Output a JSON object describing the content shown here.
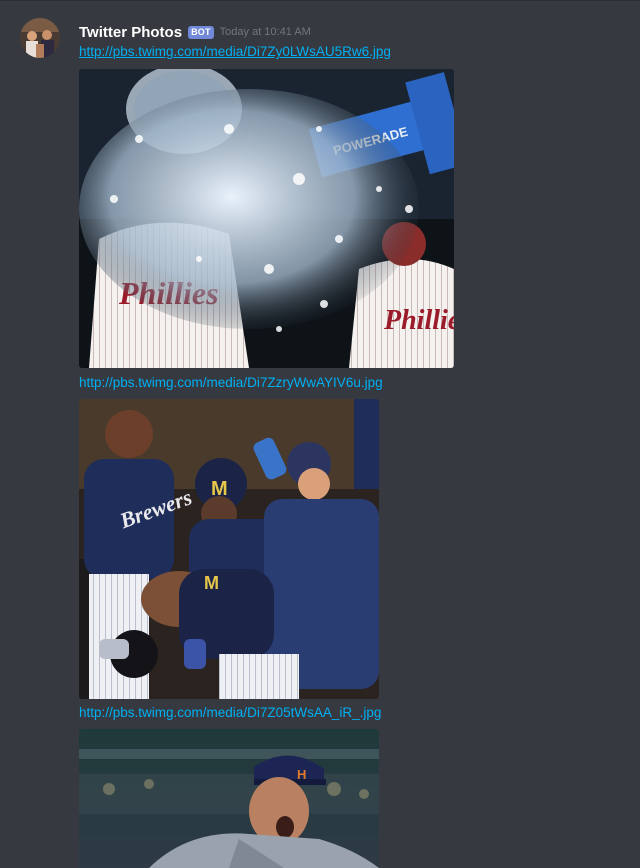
{
  "message": {
    "author": "Twitter Photos",
    "tag": "BOT",
    "timestamp": "Today at 10:41 AM",
    "first_link": "http://pbs.twimg.com/media/Di7Zy0LWsAU5Rw6.jpg"
  },
  "attachments": [
    {
      "link": "http://pbs.twimg.com/media/Di7ZzryWwAYIV6u.jpg"
    },
    {
      "link": "http://pbs.twimg.com/media/Di7Z05tWsAA_iR_.jpg"
    }
  ],
  "photo_text": {
    "phillies": "Phillies",
    "powerade": "POWERADE",
    "brewers": "Brewers",
    "brewers_cap": "M",
    "astros_cap": "H"
  },
  "colors": {
    "background": "#36393f",
    "link": "#00b0f4",
    "bot_tag": "#7289da",
    "username": "#ffffff",
    "timestamp": "#72767d"
  },
  "icons": {
    "avatar": "avatar-image",
    "photos": "photo"
  }
}
